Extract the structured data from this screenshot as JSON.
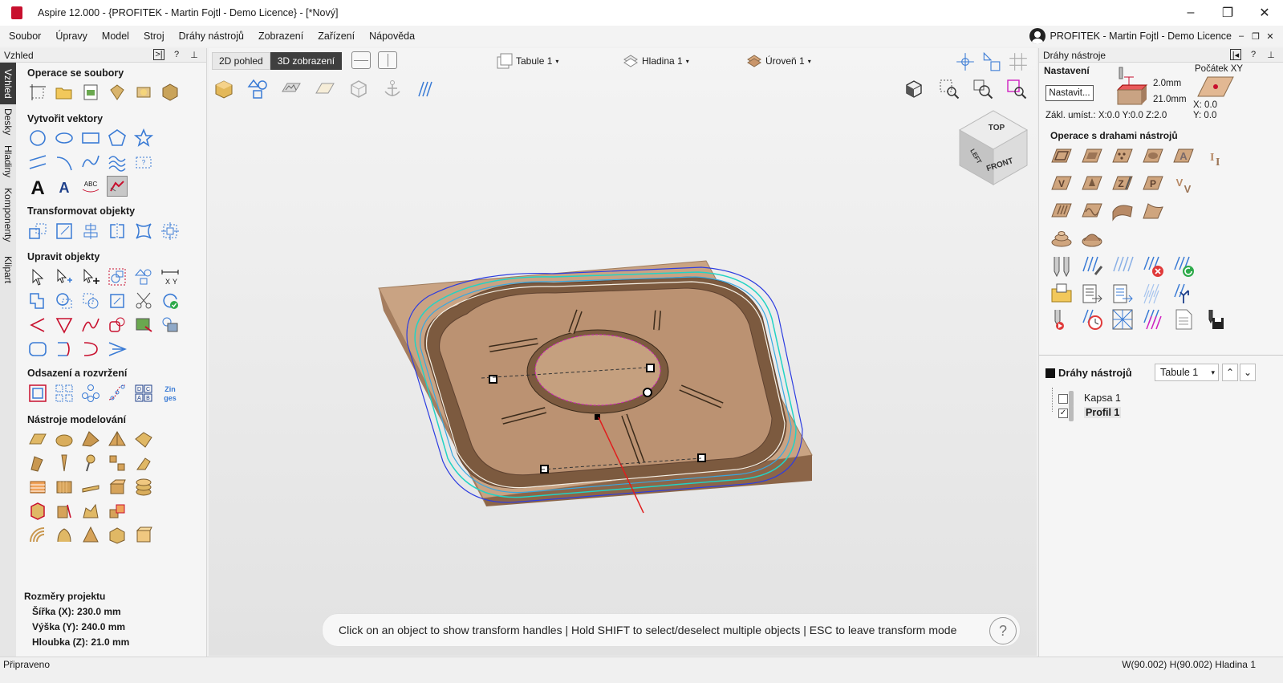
{
  "window": {
    "title": "Aspire 12.000 - {PROFITEK - Martin Fojtl - Demo Licence} - [*Nový]",
    "controls": [
      "–",
      "❐",
      "✕"
    ]
  },
  "menu": {
    "items": [
      "Soubor",
      "Úpravy",
      "Model",
      "Stroj",
      "Dráhy nástrojů",
      "Zobrazení",
      "Zařízení",
      "Nápověda"
    ],
    "user": "PROFITEK - Martin Fojtl - Demo Licence",
    "mdi_controls": [
      "–",
      "❐",
      "✕"
    ]
  },
  "left_panel": {
    "header": "Vzhled",
    "header_btns": [
      ">|",
      "?",
      "⊥"
    ],
    "vertical_tabs": [
      "Vzhled",
      "Desky",
      "Hladiny",
      "Komponenty",
      "Klipart"
    ],
    "sections": {
      "file_ops": "Operace se soubory",
      "create_vectors": "Vytvořit vektory",
      "transform": "Transformovat objekty",
      "edit": "Upravit objekty",
      "offset": "Odsazení a rozvržení",
      "modeling": "Nástroje modelování"
    },
    "project_dims": {
      "heading": "Rozměry projektu",
      "width": "Šířka   (X): 230.0 mm",
      "height": "Výška   (Y): 240.0 mm",
      "depth": "Hloubka (Z): 21.0 mm"
    }
  },
  "viewport": {
    "tabs": [
      "2D pohled",
      "3D zobrazení"
    ],
    "active_tab": "3D zobrazení",
    "sheet": "Tabule 1",
    "layer": "Hladina 1",
    "level": "Úroveň 1",
    "hint": "Click on an object to show transform handles | Hold SHIFT to select/deselect multiple objects | ESC to leave transform mode",
    "help": "?",
    "cube_labels": [
      "TOP",
      "FRONT",
      "LEFT"
    ]
  },
  "right_panel": {
    "header": "Dráhy nástroje",
    "setup_heading": "Nastavení",
    "setup_button": "Nastavit...",
    "thickness_top": "2.0mm",
    "thickness": "21.0mm",
    "origin_heading": "Počátek XY",
    "origin_x": "X: 0.0",
    "origin_y": "Y: 0.0",
    "base_position": "Zákl. umíst.: X:0.0 Y:0.0 Z:2.0",
    "ops_heading": "Operace s drahami nástrojů",
    "list_title": "Dráhy nástrojů",
    "list_sheet": "Tabule 1",
    "toolpaths": [
      {
        "name": "Kapsa 1",
        "checked": false
      },
      {
        "name": "Profil 1",
        "checked": true
      }
    ]
  },
  "statusbar": {
    "left": "Připraveno",
    "right": "W(90.002) H(90.002) Hladina 1"
  },
  "colors": {
    "accent_blue": "#3a7bd5",
    "wood": "#c9a383",
    "toolpath_cyan": "#22d3c5",
    "active_tab": "#3f3f3f"
  }
}
